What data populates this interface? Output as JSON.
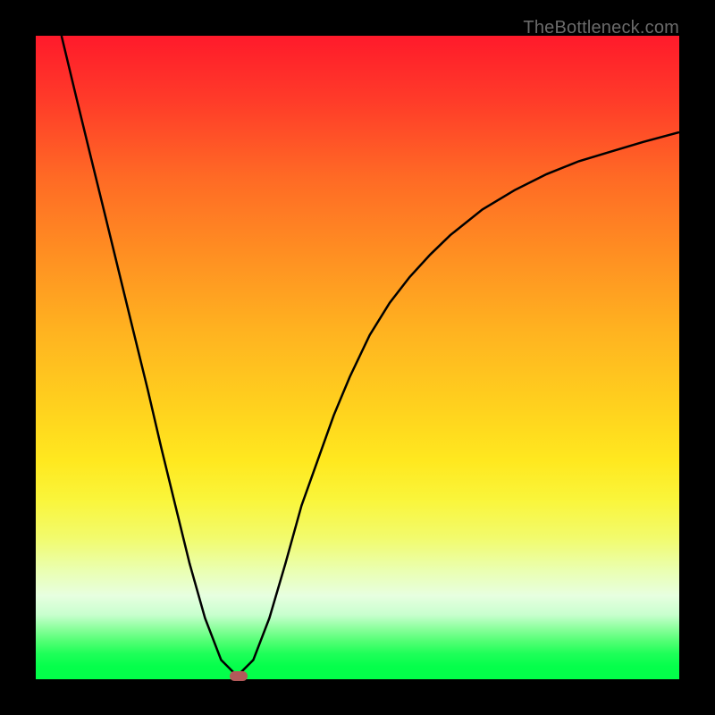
{
  "watermark": "TheBottleneck.com",
  "chart_data": {
    "type": "line",
    "title": "",
    "xlabel": "",
    "ylabel": "",
    "x_range": [
      0,
      100
    ],
    "y_range": [
      0,
      100
    ],
    "grid": false,
    "curve": {
      "name": "",
      "color": "#000000",
      "x": [
        4.0,
        6.4,
        8.6,
        10.8,
        13.0,
        15.2,
        17.4,
        19.5,
        21.7,
        23.9,
        26.3,
        28.8,
        31.3,
        33.8,
        36.3,
        38.8,
        41.3,
        43.8,
        46.3,
        48.8,
        51.9,
        55.0,
        58.1,
        61.3,
        64.4,
        69.4,
        74.4,
        79.4,
        84.4,
        89.4,
        94.4,
        100.0
      ],
      "y": [
        100.0,
        90.0,
        81.0,
        72.0,
        63.0,
        54.0,
        45.0,
        36.0,
        27.0,
        18.0,
        9.5,
        3.0,
        0.5,
        3.0,
        9.5,
        18.0,
        27.0,
        34.0,
        41.0,
        47.0,
        53.5,
        58.5,
        62.5,
        66.0,
        69.0,
        73.0,
        76.0,
        78.5,
        80.5,
        82.0,
        83.5,
        85.0
      ]
    },
    "marker": {
      "x": 31.5,
      "y": 0.5,
      "color": "#b35a5a"
    },
    "background_gradient": "red→orange→yellow→green (top→bottom)"
  }
}
